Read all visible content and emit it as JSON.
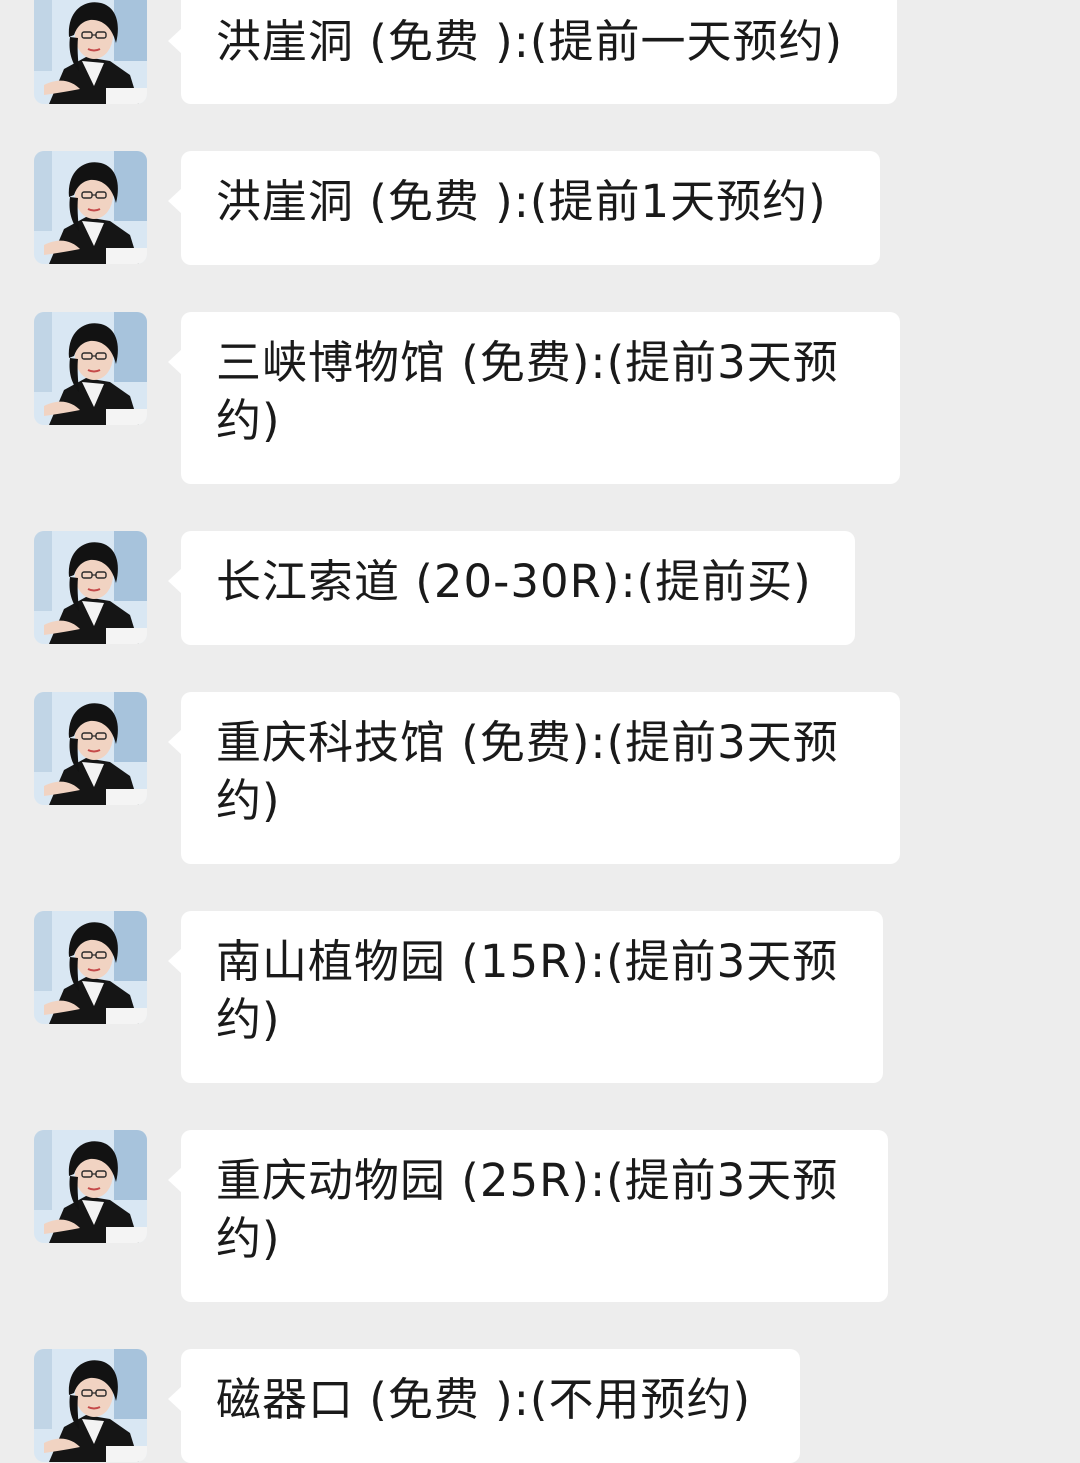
{
  "messages": [
    {
      "text": "洪崖洞 (免费 ):(提前一天预约)",
      "avatar_icon": "profile-photo"
    },
    {
      "text": "洪崖洞 (免费 ):(提前1天预约)",
      "avatar_icon": "profile-photo"
    },
    {
      "text": "三峡博物馆 (免费):(提前3天预约)",
      "avatar_icon": "profile-photo"
    },
    {
      "text": "长江索道 (20-30R):(提前买)",
      "avatar_icon": "profile-photo"
    },
    {
      "text": "重庆科技馆 (免费):(提前3天预约)",
      "avatar_icon": "profile-photo"
    },
    {
      "text": "南山植物园 (15R):(提前3天预约)",
      "avatar_icon": "profile-photo"
    },
    {
      "text": "重庆动物园 (25R):(提前3天预约)",
      "avatar_icon": "profile-photo"
    },
    {
      "text": "磁器口 (免费 ):(不用预约)",
      "avatar_icon": "profile-photo"
    }
  ],
  "colors": {
    "background": "#ededed",
    "bubble": "#ffffff",
    "text": "#1a1a1a"
  }
}
